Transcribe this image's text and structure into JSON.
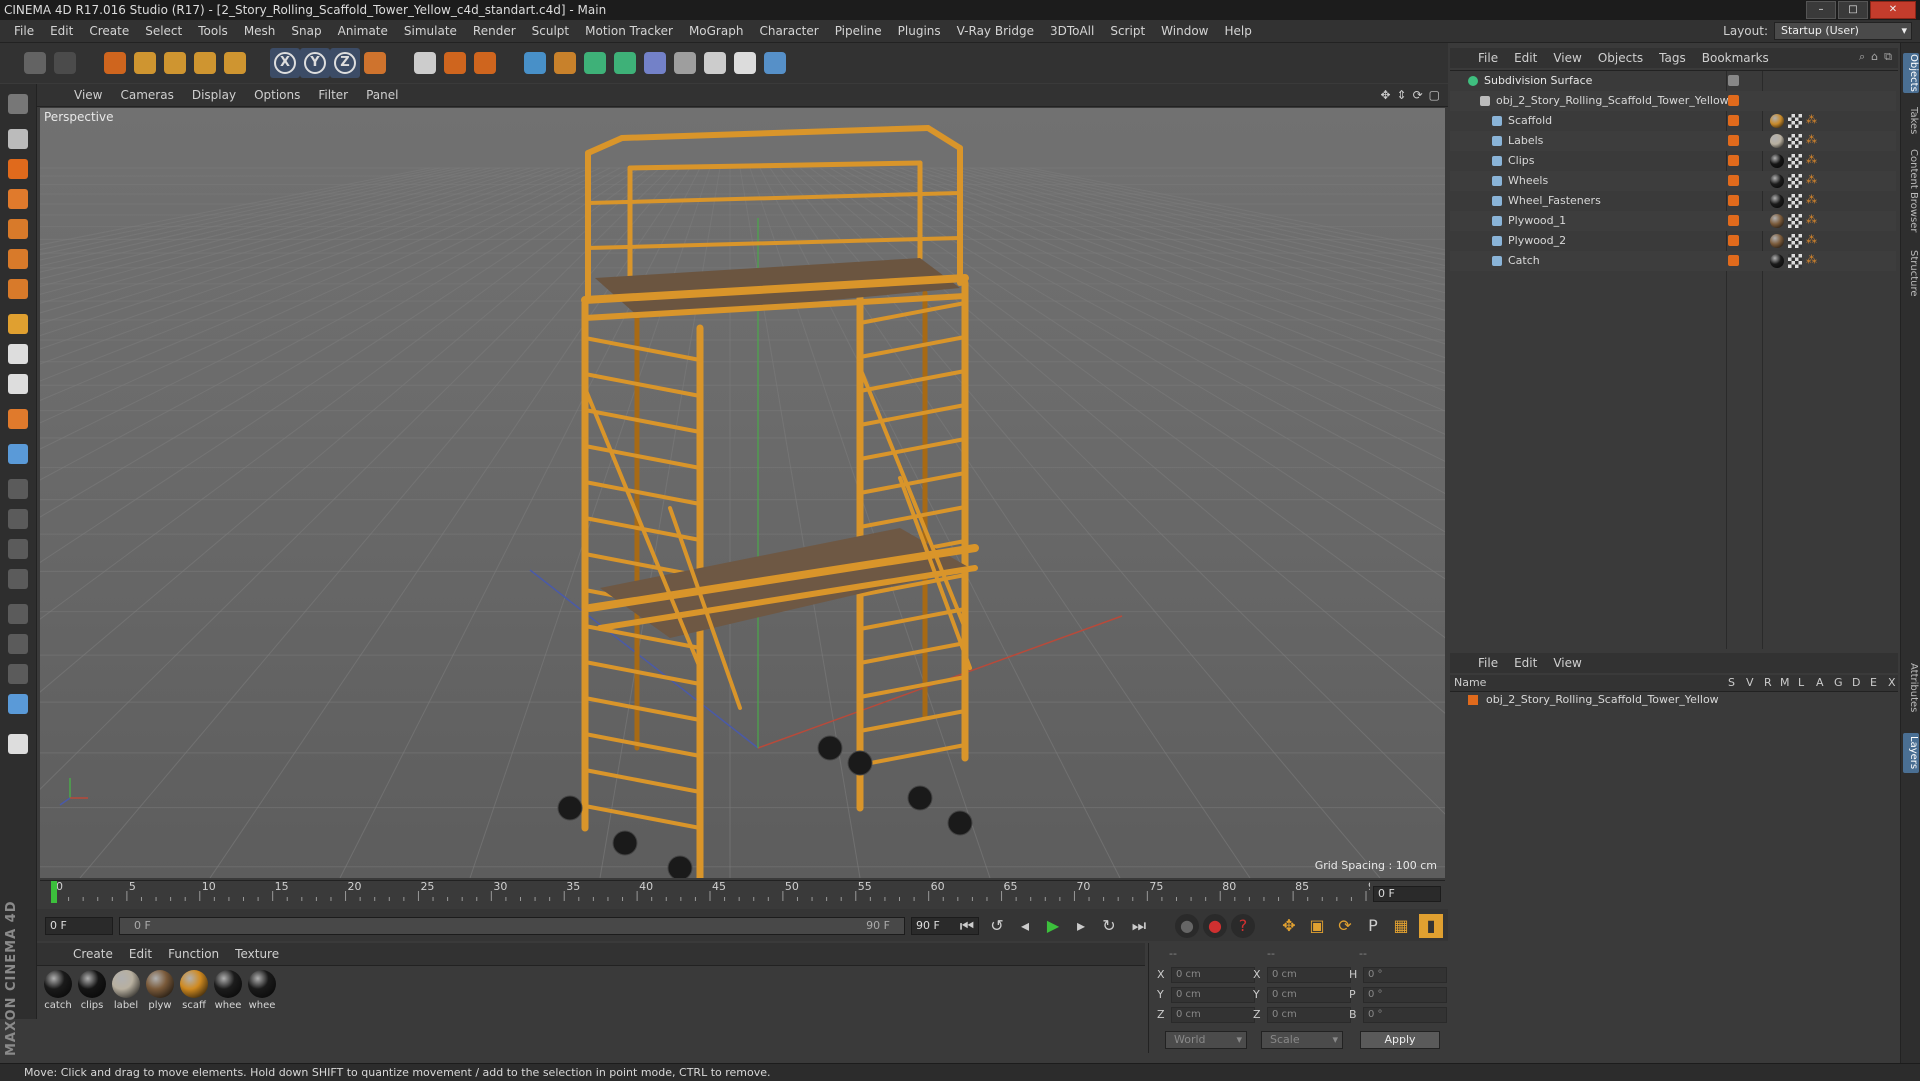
{
  "window": {
    "title": "CINEMA 4D R17.016 Studio (R17) - [2_Story_Rolling_Scaffold_Tower_Yellow_c4d_standart.c4d] - Main"
  },
  "menubar": {
    "items": [
      "File",
      "Edit",
      "Create",
      "Select",
      "Tools",
      "Mesh",
      "Snap",
      "Animate",
      "Simulate",
      "Render",
      "Sculpt",
      "Motion Tracker",
      "MoGraph",
      "Character",
      "Pipeline",
      "Plugins",
      "V-Ray Bridge",
      "3DToAll",
      "Script",
      "Window",
      "Help"
    ],
    "layout_label": "Layout:",
    "layout_value": "Startup (User)"
  },
  "toolbar": {
    "icons": [
      "undo-icon",
      "redo-icon",
      "live-selection-icon",
      "move-icon",
      "scale-icon",
      "rotate-icon",
      "transform-icon",
      "x-axis-icon",
      "y-axis-icon",
      "z-axis-icon",
      "coordinate-system-icon",
      "render-view-icon",
      "render-picture-viewer-icon",
      "render-settings-icon",
      "cube-icon",
      "pen-spline-icon",
      "subdivision-icon",
      "array-icon",
      "deformer-icon",
      "floor-icon",
      "camera-icon",
      "light-icon",
      "python-icon"
    ]
  },
  "viewport": {
    "menu": [
      "View",
      "Cameras",
      "Display",
      "Options",
      "Filter",
      "Panel"
    ],
    "label": "Perspective",
    "grid_spacing": "Grid Spacing : 100 cm"
  },
  "timeline": {
    "ticks": [
      "0",
      "5",
      "10",
      "15",
      "20",
      "25",
      "30",
      "35",
      "40",
      "45",
      "50",
      "55",
      "60",
      "65",
      "70",
      "75",
      "80",
      "85",
      "90"
    ],
    "current_frame_field": "0 F"
  },
  "transport": {
    "start_field": "0 F",
    "range_start": "0 F",
    "range_end": "90 F",
    "end_field": "90 F"
  },
  "material_manager": {
    "menu": [
      "Create",
      "Edit",
      "Function",
      "Texture"
    ],
    "materials": [
      {
        "label": "catch",
        "color": "#1a1a1a"
      },
      {
        "label": "clips",
        "color": "#151515"
      },
      {
        "label": "label",
        "color": "#b8b0a0"
      },
      {
        "label": "plyw",
        "color": "#7a5a3a"
      },
      {
        "label": "scaff",
        "color": "#d08a20"
      },
      {
        "label": "whee",
        "color": "#1c1c1c"
      },
      {
        "label": "whee",
        "color": "#1a1a1a"
      }
    ]
  },
  "coordinates": {
    "header": [
      "--",
      "--",
      "--"
    ],
    "rows": [
      {
        "a": "X",
        "av": "0 cm",
        "b": "X",
        "bv": "0 cm",
        "c": "H",
        "cv": "0 °"
      },
      {
        "a": "Y",
        "av": "0 cm",
        "b": "Y",
        "bv": "0 cm",
        "c": "P",
        "cv": "0 °"
      },
      {
        "a": "Z",
        "av": "0 cm",
        "b": "Z",
        "bv": "0 cm",
        "c": "B",
        "cv": "0 °"
      }
    ],
    "space": "World",
    "mode": "Scale",
    "apply": "Apply"
  },
  "object_manager": {
    "menu": [
      "File",
      "Edit",
      "View",
      "Objects",
      "Tags",
      "Bookmarks"
    ],
    "objects": [
      {
        "name": "Subdivision Surface",
        "level": 0
      },
      {
        "name": "obj_2_Story_Rolling_Scaffold_Tower_Yellow",
        "level": 1
      },
      {
        "name": "Scaffold",
        "level": 2
      },
      {
        "name": "Labels",
        "level": 2
      },
      {
        "name": "Clips",
        "level": 2
      },
      {
        "name": "Wheels",
        "level": 2
      },
      {
        "name": "Wheel_Fasteners",
        "level": 2
      },
      {
        "name": "Plywood_1",
        "level": 2
      },
      {
        "name": "Plywood_2",
        "level": 2
      },
      {
        "name": "Catch",
        "level": 2
      }
    ],
    "tag_colors": [
      "#c88a2a",
      "#b8b0a0",
      "#151515",
      "#1c1c1c",
      "#1a1a1a",
      "#7a5a3a",
      "#7a5a3a",
      "#1a1a1a"
    ]
  },
  "layer_manager": {
    "menu": [
      "File",
      "Edit",
      "View"
    ],
    "columns": [
      "Name",
      "S",
      "V",
      "R",
      "M",
      "L",
      "A",
      "G",
      "D",
      "E",
      "X"
    ],
    "layer": "obj_2_Story_Rolling_Scaffold_Tower_Yellow"
  },
  "right_tabs": [
    "Objects",
    "Takes",
    "Content Browser",
    "Structure",
    "Attributes",
    "Layers"
  ],
  "status": "Move: Click and drag to move elements. Hold down SHIFT to quantize movement / add to the selection in point mode, CTRL to remove.",
  "logo": "MAXON CINEMA 4D",
  "colors": {
    "accent": "#e06a1c",
    "scaffold": "#d9952a",
    "selection": "#4a6f93"
  }
}
